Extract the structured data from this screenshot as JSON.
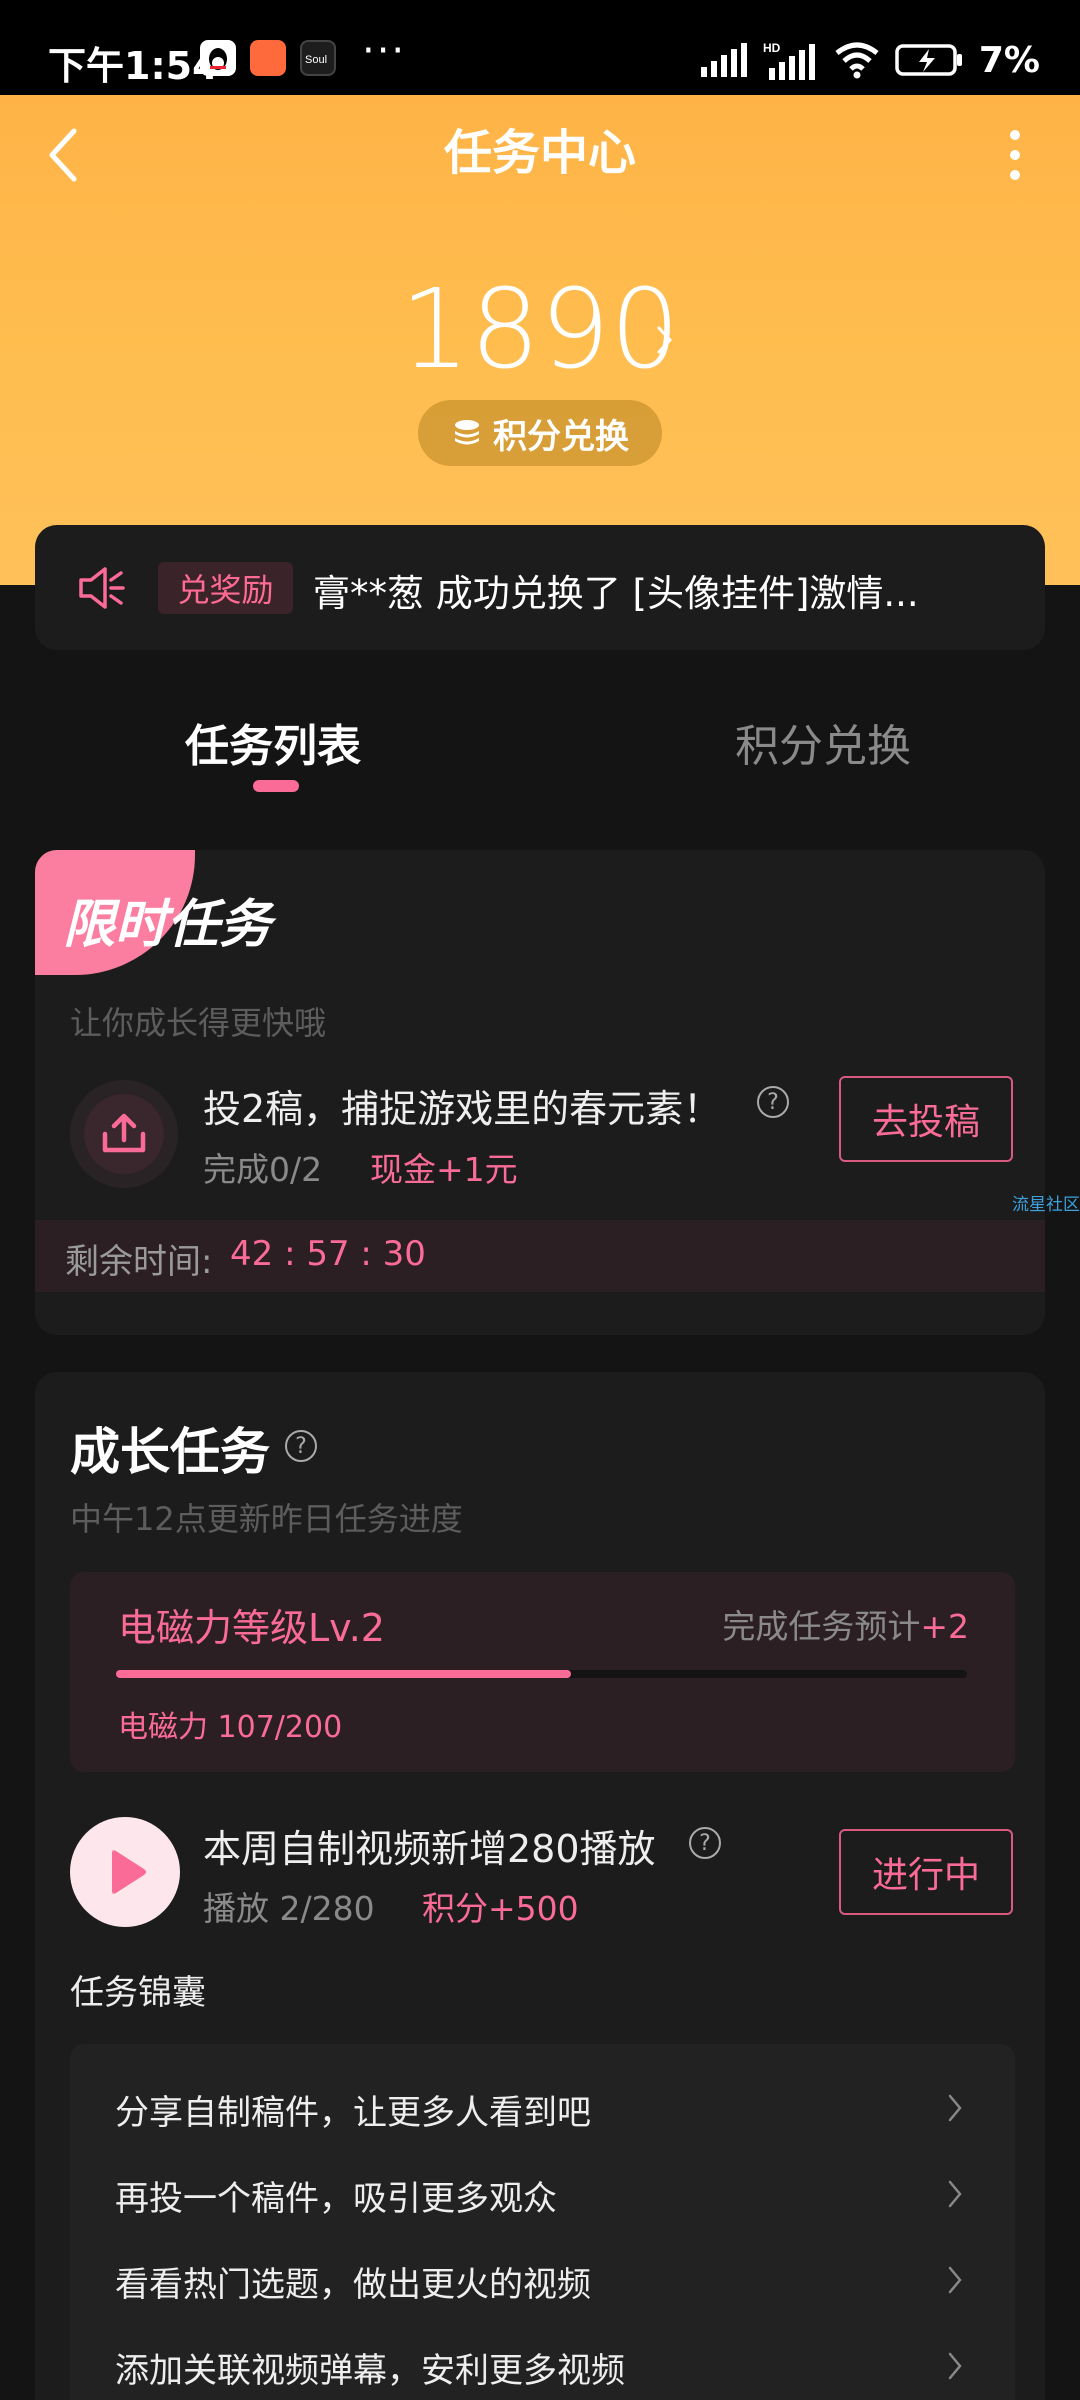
{
  "status_bar": {
    "time": "下午1:54",
    "battery_pct": "7%",
    "overflow": "···",
    "app_icons": [
      "qq-icon",
      "orange-app-icon",
      "soul-app-icon"
    ]
  },
  "header": {
    "title": "任务中心",
    "points": "1890",
    "exchange_label": "积分兑换"
  },
  "notice": {
    "badge": "兑奖励",
    "text": "膏**葱 成功兑换了 [头像挂件]激情..."
  },
  "tabs": [
    {
      "label": "任务列表",
      "active": true
    },
    {
      "label": "积分兑换",
      "active": false
    }
  ],
  "limited_task": {
    "badge_title": "限时任务",
    "subtitle": "让你成长得更快哦",
    "title": "投2稿，捕捉游戏里的春元素！",
    "progress": "完成0/2",
    "reward": "现金+1元",
    "button": "去投稿",
    "time_label": "剩余时间:",
    "time_value": "42 : 57 : 30"
  },
  "side_link": "流星社区",
  "growth": {
    "title": "成长任务",
    "subtitle": "中午12点更新昨日任务进度",
    "level_name": "电磁力等级Lv.2",
    "estimate_prefix": "完成任务预计",
    "estimate_value": "+2",
    "power_text": "电磁力 107/200",
    "power_progress": 0.535,
    "task_title": "本周自制视频新增280播放",
    "task_progress": "播放 2/280",
    "task_reward": "积分+500",
    "task_button": "进行中",
    "tips_label": "任务锦囊",
    "tips": [
      "分享自制稿件，让更多人看到吧",
      "再投一个稿件，吸引更多观众",
      "看看热门选题，做出更火的视频",
      "添加关联视频弹幕，安利更多视频"
    ]
  },
  "colors": {
    "accent": "#fb6b98",
    "header_gradient_top": "#ffb347",
    "header_gradient_bottom": "#ffc05a",
    "background": "#141414",
    "card": "#1c1c1c"
  }
}
